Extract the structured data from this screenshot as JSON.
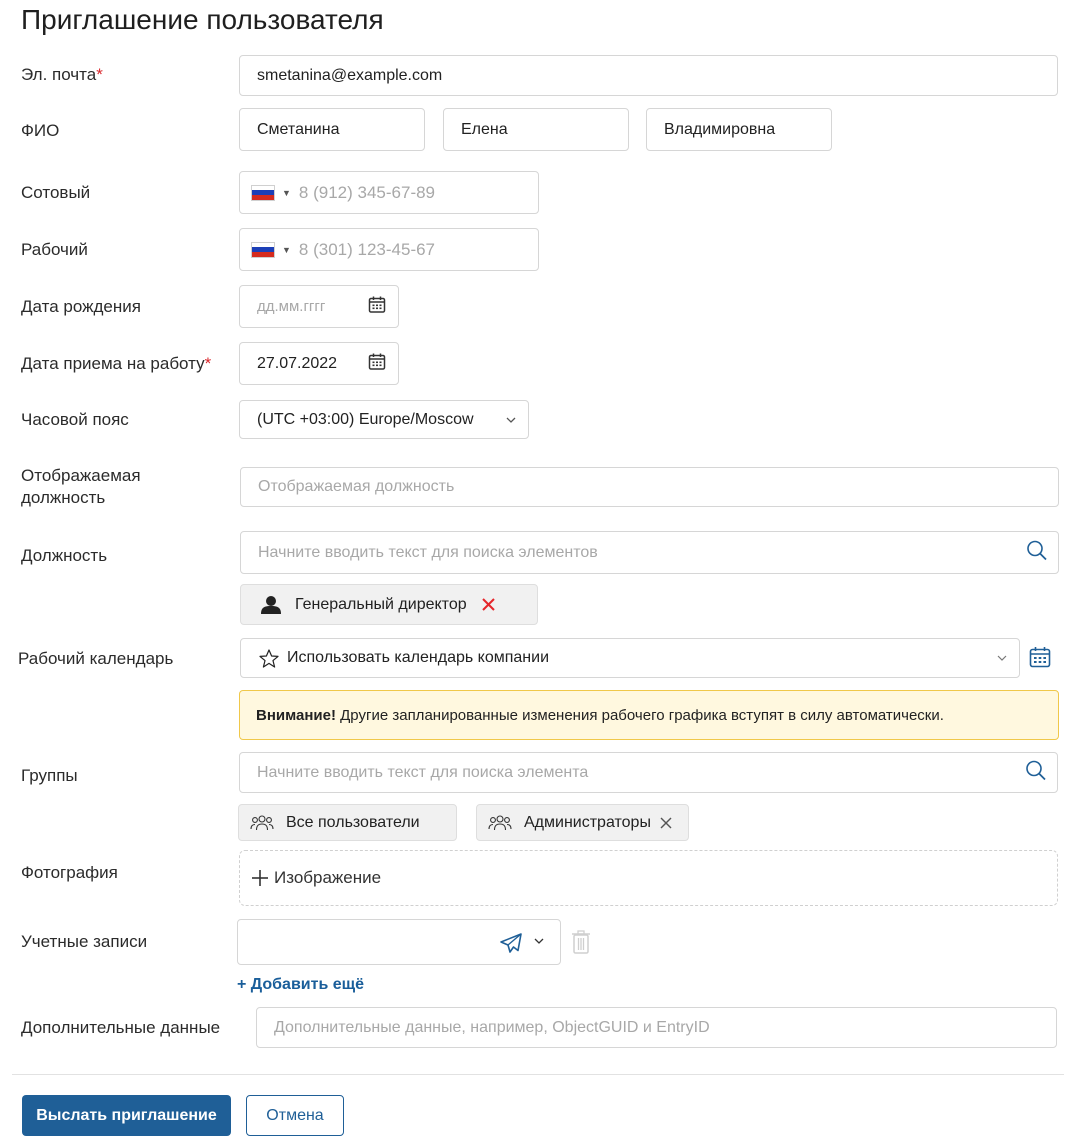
{
  "page": {
    "title": "Приглашение пользователя"
  },
  "form": {
    "email": {
      "label": "Эл. почта",
      "required": "*",
      "value": "smetanina@example.com"
    },
    "fio": {
      "label": "ФИО",
      "last_name": "Сметанина",
      "first_name": "Елена",
      "middle_name": "Владимировна"
    },
    "mobile": {
      "label": "Сотовый",
      "placeholder": "8 (912) 345-67-89",
      "country_icon": "russia-flag-icon"
    },
    "work_phone": {
      "label": "Рабочий",
      "placeholder": "8 (301) 123-45-67",
      "country_icon": "russia-flag-icon"
    },
    "birth_date": {
      "label": "Дата рождения",
      "placeholder": "дд.мм.гггг"
    },
    "hire_date": {
      "label": "Дата приема на работу",
      "required": "*",
      "value": "27.07.2022"
    },
    "timezone": {
      "label": "Часовой пояс",
      "value": "(UTC +03:00) Europe/Moscow"
    },
    "display_position": {
      "label_line1": "Отображаемая",
      "label_line2": "должность",
      "placeholder": "Отображаемая должность"
    },
    "position": {
      "label": "Должность",
      "placeholder": "Начните вводить текст для поиска элементов",
      "selected": {
        "label": "Генеральный директор",
        "icon": "person-icon"
      }
    },
    "work_calendar": {
      "label": "Рабочий календарь",
      "value": "Использовать календарь компании",
      "warning_bold": "Внимание!",
      "warning_text": " Другие запланированные изменения рабочего графика вступят в силу автоматически."
    },
    "groups": {
      "label": "Группы",
      "placeholder": "Начните вводить текст для поиска элемента",
      "chips": [
        {
          "label": "Все пользователи",
          "icon": "users-group-icon"
        },
        {
          "label": "Администраторы",
          "icon": "users-group-icon"
        }
      ]
    },
    "photo": {
      "label": "Фотография",
      "add_label": "Изображение"
    },
    "accounts": {
      "label": "Учетные записи",
      "add_more": "+ Добавить ещё",
      "value": ""
    },
    "extra": {
      "label": "Дополнительные данные",
      "placeholder": "Дополнительные данные, например, ObjectGUID и EntryID"
    }
  },
  "actions": {
    "submit": "Выслать приглашение",
    "cancel": "Отмена"
  },
  "colors": {
    "primary": "#1f5f97",
    "required": "#d9262b",
    "warning_bg": "#fff8df",
    "warning_border": "#f0c84a",
    "remove_red": "#e5262b"
  }
}
